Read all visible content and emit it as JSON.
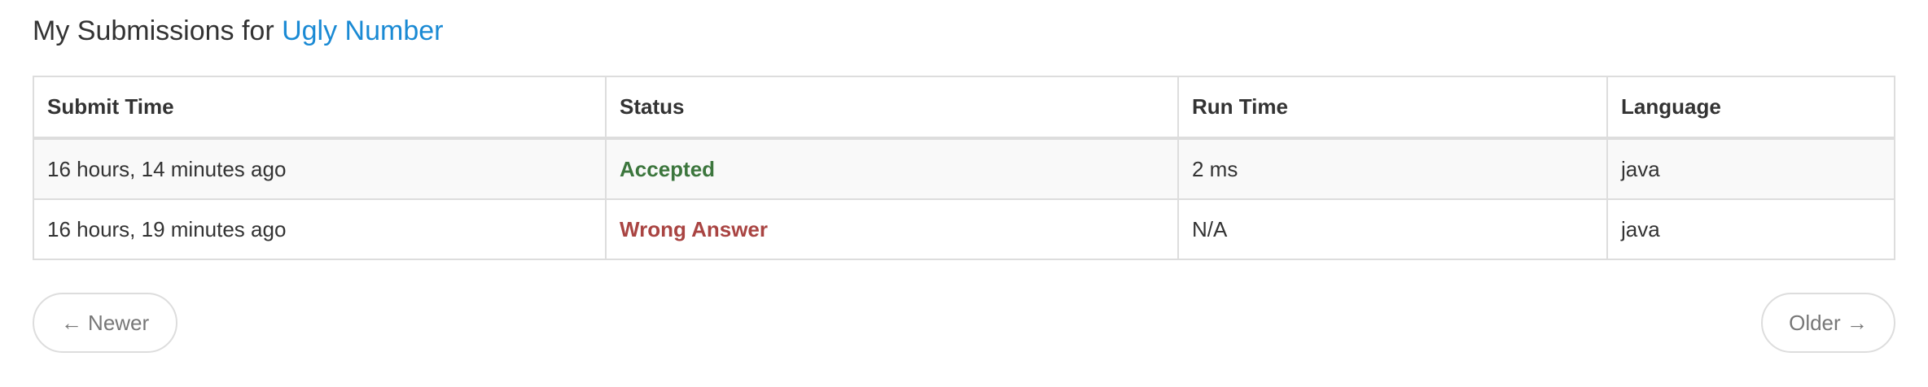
{
  "heading": {
    "prefix": "My Submissions for",
    "problem": "Ugly Number"
  },
  "table": {
    "columns": [
      "Submit Time",
      "Status",
      "Run Time",
      "Language"
    ],
    "rows": [
      {
        "submit_time": "16 hours, 14 minutes ago",
        "status": "Accepted",
        "run_time": "2 ms",
        "language": "java"
      },
      {
        "submit_time": "16 hours, 19 minutes ago",
        "status": "Wrong Answer",
        "run_time": "N/A",
        "language": "java"
      }
    ]
  },
  "pager": {
    "newer": "← Newer",
    "older": "Older →"
  },
  "colors": {
    "link": "#1a8ad4",
    "accepted": "#3c763d",
    "wrong_answer": "#a94442"
  }
}
